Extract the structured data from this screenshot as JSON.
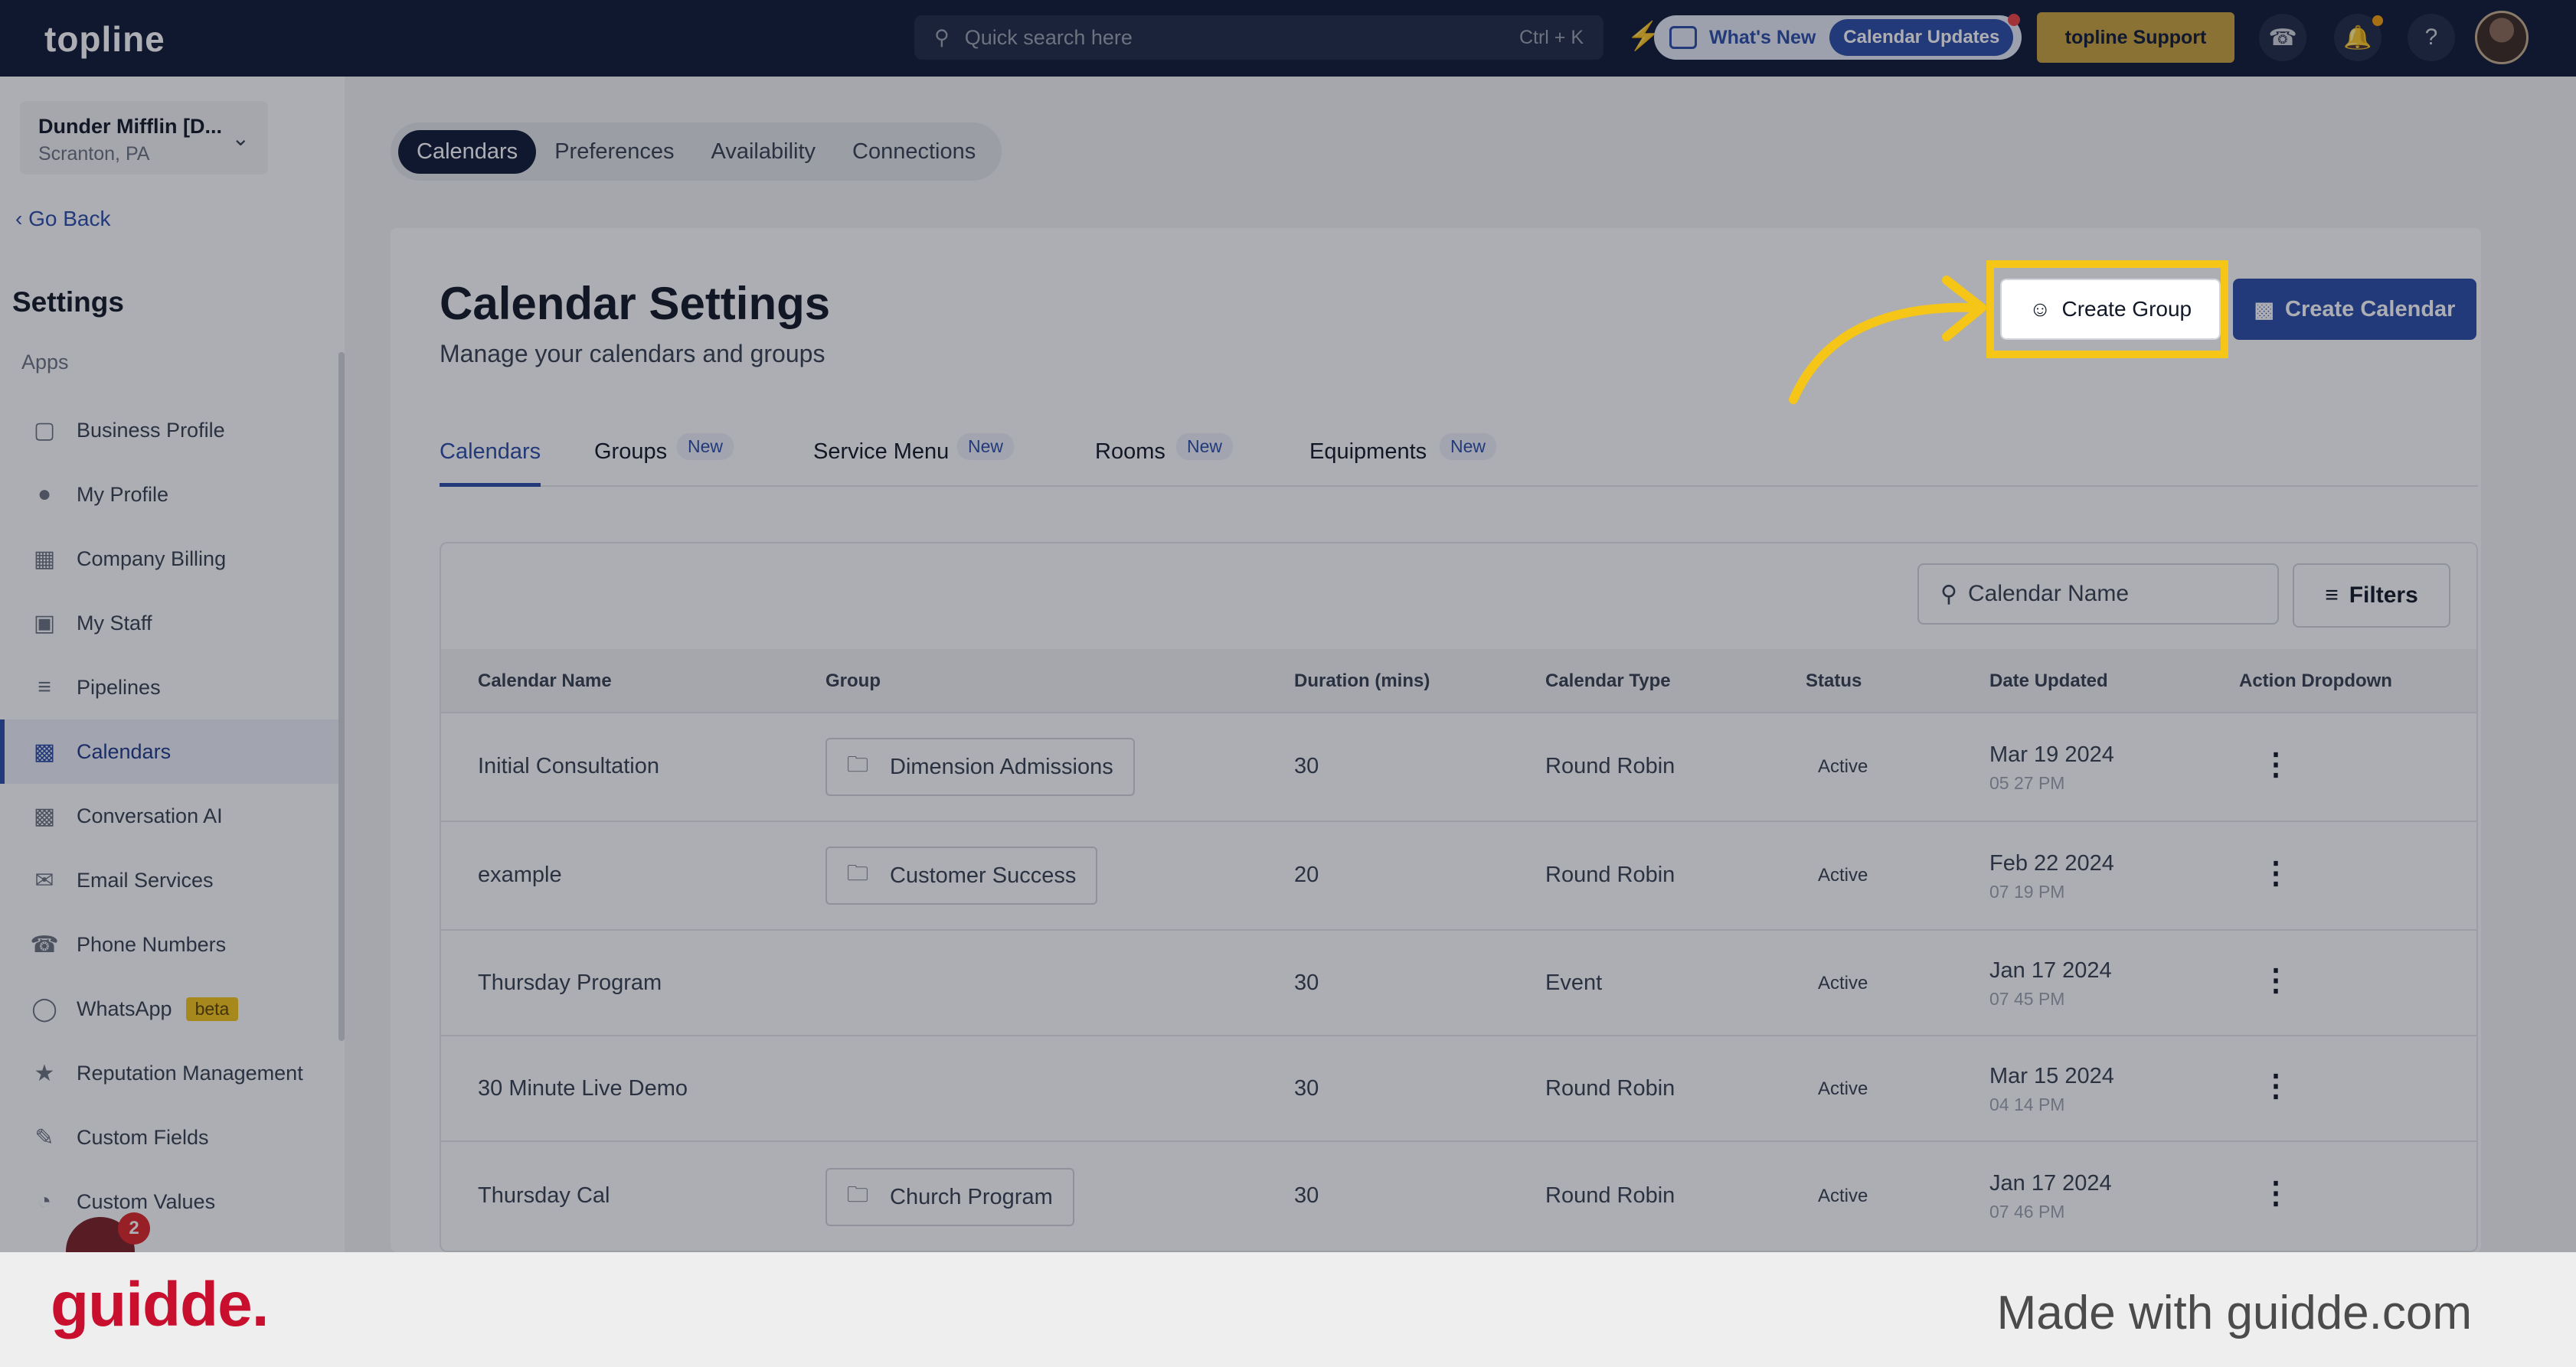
{
  "topbar": {
    "logo": "topline",
    "search_placeholder": "Quick search here",
    "search_shortcut": "Ctrl + K",
    "whats_new_label": "What's New",
    "whats_new_pill": "Calendar Updates",
    "support_label": "topline Support"
  },
  "sidebar": {
    "account_name": "Dunder Mifflin [D...",
    "account_location": "Scranton, PA",
    "go_back": "Go Back",
    "settings_title": "Settings",
    "apps_label": "Apps",
    "items": [
      {
        "label": "Business Profile",
        "icon": "briefcase-icon",
        "active": false
      },
      {
        "label": "My Profile",
        "icon": "user-icon",
        "active": false
      },
      {
        "label": "Company Billing",
        "icon": "grid-icon",
        "active": false
      },
      {
        "label": "My Staff",
        "icon": "staff-icon",
        "active": false
      },
      {
        "label": "Pipelines",
        "icon": "filter-icon",
        "active": false
      },
      {
        "label": "Calendars",
        "icon": "calendar-icon",
        "active": true
      },
      {
        "label": "Conversation AI",
        "icon": "chat-icon",
        "active": false
      },
      {
        "label": "Email Services",
        "icon": "email-icon",
        "active": false
      },
      {
        "label": "Phone Numbers",
        "icon": "phone-icon",
        "active": false
      },
      {
        "label": "WhatsApp",
        "icon": "whatsapp-icon",
        "active": false,
        "badge": "beta"
      },
      {
        "label": "Reputation Management",
        "icon": "star-icon",
        "active": false
      },
      {
        "label": "Custom Fields",
        "icon": "edit-icon",
        "active": false
      },
      {
        "label": "Custom Values",
        "icon": "pie-icon",
        "active": false
      }
    ],
    "chat_badge": "2"
  },
  "top_tabs": [
    {
      "label": "Calendars",
      "active": true
    },
    {
      "label": "Preferences",
      "active": false
    },
    {
      "label": "Availability",
      "active": false
    },
    {
      "label": "Connections",
      "active": false
    }
  ],
  "page": {
    "title": "Calendar Settings",
    "subtitle": "Manage your calendars and groups",
    "create_group_label": "Create Group",
    "create_calendar_label": "Create Calendar"
  },
  "sub_tabs": [
    {
      "label": "Calendars",
      "active": true,
      "badge": ""
    },
    {
      "label": "Groups",
      "active": false,
      "badge": "New"
    },
    {
      "label": "Service Menu",
      "active": false,
      "badge": "New"
    },
    {
      "label": "Rooms",
      "active": false,
      "badge": "New"
    },
    {
      "label": "Equipments",
      "active": false,
      "badge": "New"
    }
  ],
  "table": {
    "search_placeholder": "Calendar Name",
    "filters_label": "Filters",
    "headers": [
      "Calendar Name",
      "Group",
      "Duration (mins)",
      "Calendar Type",
      "Status",
      "Date Updated",
      "Action Dropdown"
    ],
    "rows": [
      {
        "name": "Initial Consultation",
        "group": "Dimension Admissions",
        "duration": "30",
        "type": "Round Robin",
        "status": "Active",
        "date": "Mar 19 2024",
        "time": "05 27 PM"
      },
      {
        "name": "example",
        "group": "Customer Success",
        "duration": "20",
        "type": "Round Robin",
        "status": "Active",
        "date": "Feb 22 2024",
        "time": "07 19 PM"
      },
      {
        "name": "Thursday Program",
        "group": "",
        "duration": "30",
        "type": "Event",
        "status": "Active",
        "date": "Jan 17 2024",
        "time": "07 45 PM"
      },
      {
        "name": "30 Minute Live Demo",
        "group": "",
        "duration": "30",
        "type": "Round Robin",
        "status": "Active",
        "date": "Mar 15 2024",
        "time": "04 14 PM"
      },
      {
        "name": "Thursday Cal",
        "group": "Church Program",
        "duration": "30",
        "type": "Round Robin",
        "status": "Active",
        "date": "Jan 17 2024",
        "time": "07 46 PM"
      }
    ]
  },
  "footer": {
    "brand": "guidde.",
    "tagline": "Made with guidde.com"
  },
  "colors": {
    "accent": "#2b4da8",
    "topbar": "#0e1a35",
    "highlight": "#f5c518",
    "support": "#caa23c",
    "brand_red": "#c8102e"
  }
}
